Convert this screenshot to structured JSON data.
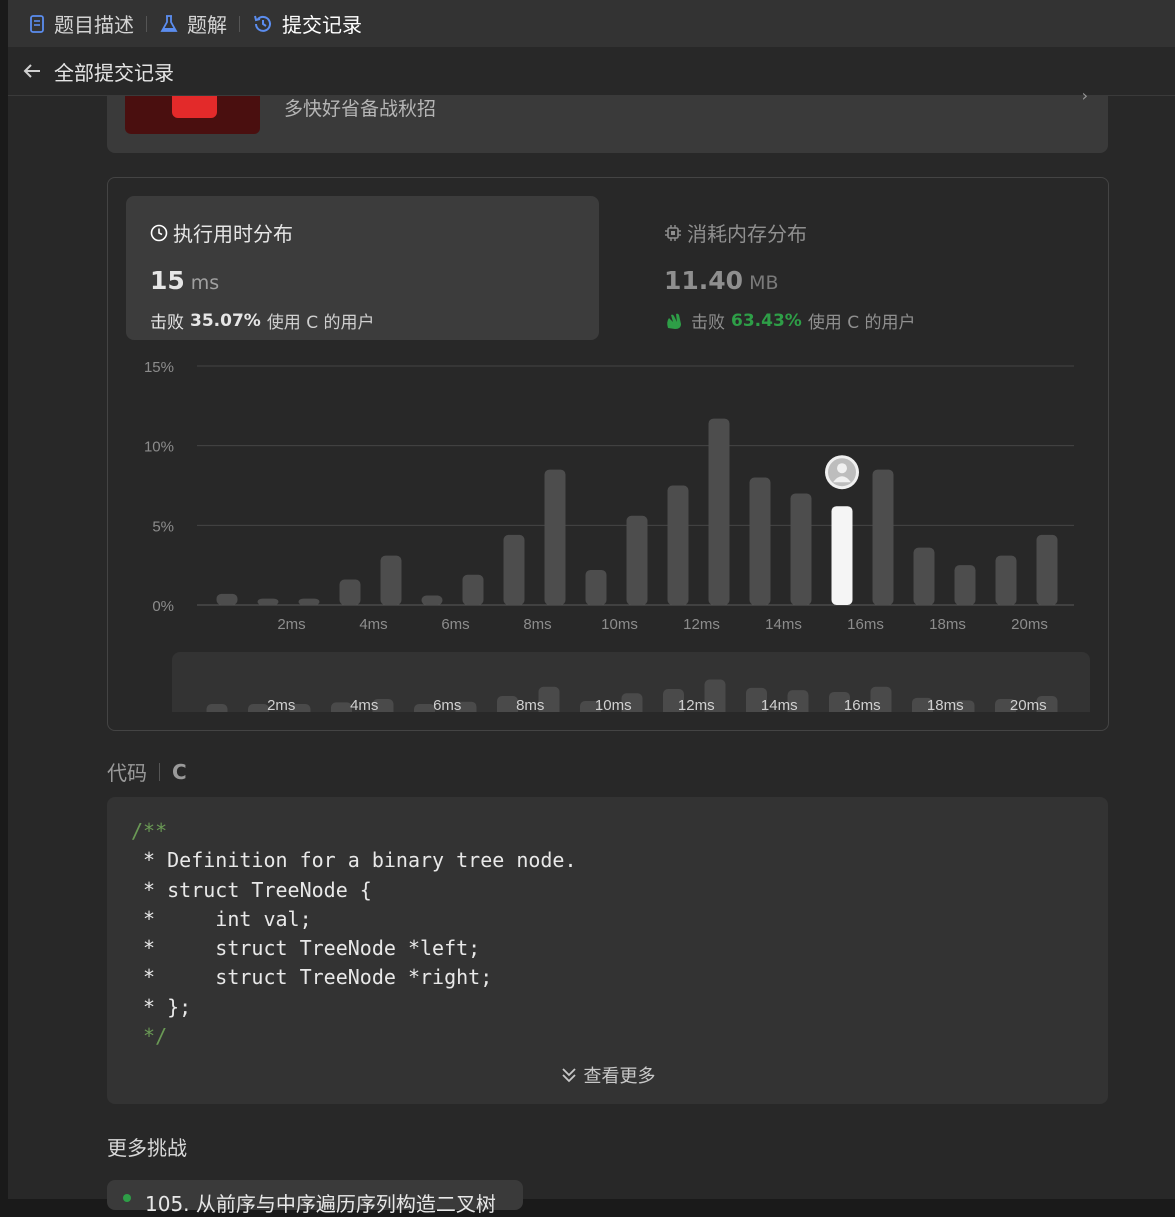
{
  "tabs": [
    {
      "label": "题目描述",
      "icon": "document-icon"
    },
    {
      "label": "题解",
      "icon": "flask-icon"
    },
    {
      "label": "提交记录",
      "icon": "history-icon",
      "active": true
    }
  ],
  "subheader": {
    "title": "全部提交记录"
  },
  "promo": {
    "text": "多快好省备战秋招"
  },
  "runtime": {
    "title": "执行用时分布",
    "value": "15",
    "unit": "ms",
    "beat_prefix": "击败",
    "beat_pct": "35.07%",
    "beat_suffix": "使用 C 的用户"
  },
  "memory": {
    "title": "消耗内存分布",
    "value": "11.40",
    "unit": "MB",
    "beat_prefix": "击败",
    "beat_pct": "63.43%",
    "beat_suffix": "使用 C 的用户"
  },
  "chart_data": {
    "type": "bar",
    "ylim": [
      0,
      15
    ],
    "yticks": [
      "0%",
      "5%",
      "10%",
      "15%"
    ],
    "ytick_values": [
      0,
      5,
      10,
      15
    ],
    "x_labels": [
      "2ms",
      "4ms",
      "6ms",
      "8ms",
      "10ms",
      "12ms",
      "14ms",
      "16ms",
      "18ms",
      "20ms"
    ],
    "values": [
      0.7,
      0.4,
      0.4,
      1.6,
      3.1,
      0.6,
      1.9,
      4.4,
      8.5,
      2.2,
      5.6,
      7.5,
      11.7,
      8.0,
      7.0,
      6.2,
      8.5,
      3.6,
      2.5,
      3.1,
      4.4
    ],
    "highlight_index": 15,
    "highlight_color": "#f5f5f5",
    "bar_color": "#4d4d4d",
    "grid": true
  },
  "mini_chart": {
    "x_labels": [
      "2ms",
      "4ms",
      "6ms",
      "8ms",
      "10ms",
      "12ms",
      "14ms",
      "16ms",
      "18ms",
      "20ms"
    ]
  },
  "code": {
    "label": "代码",
    "lang": "C",
    "lines": [
      {
        "text": "/**",
        "comment": true
      },
      {
        "text": " * Definition for a binary tree node.",
        "comment": false
      },
      {
        "text": " * struct TreeNode {",
        "comment": false
      },
      {
        "text": " *     int val;",
        "comment": false
      },
      {
        "text": " *     struct TreeNode *left;",
        "comment": false
      },
      {
        "text": " *     struct TreeNode *right;",
        "comment": false
      },
      {
        "text": " * };",
        "comment": false
      },
      {
        "text": " */",
        "comment": true
      }
    ],
    "view_more": "查看更多"
  },
  "more": {
    "title": "更多挑战",
    "item": "105. 从前序与中序遍历序列构造二叉树"
  }
}
